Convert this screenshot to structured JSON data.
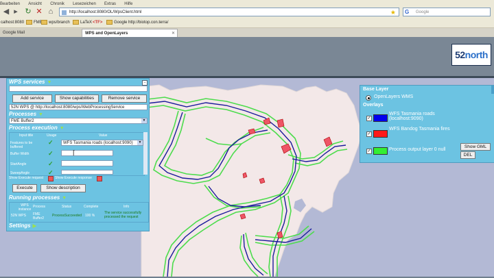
{
  "browser": {
    "menu": [
      "Bearbeiten",
      "Ansicht",
      "Chronik",
      "Lesezeichen",
      "Extras",
      "Hilfe"
    ],
    "url": "http://localhost:8080/OL/WpsClient.html",
    "search_placeholder": "Google",
    "bookmarks": [
      "calhost:8080",
      "FME",
      "wps/branch",
      "LaTeX",
      "<TF>",
      "Google",
      "http://biotop.con.terra/"
    ],
    "tabs": [
      "Google Mail",
      "WPS and OpenLayers"
    ]
  },
  "logo": {
    "prefix": "52",
    "suffix": "north"
  },
  "wps_panel": {
    "title": "WPS services",
    "buttons": {
      "add": "Add service",
      "capabilities": "Show capabilities",
      "remove": "Remove service"
    },
    "service_url": "52N WPS @ http://localhost:8080/wps/WebProcessingService",
    "processes_title": "Processes",
    "selected_process": "FME Buffer2",
    "execution_title": "Process execution",
    "exec_headers": [
      "Input title",
      "Usage",
      "Value"
    ],
    "exec_rows": [
      {
        "label": "Features to be buffered",
        "value": "WFS Tasmania roads (localhost:9090)"
      },
      {
        "label": "Buffer Width",
        "value": ""
      },
      {
        "label": "StartAngle",
        "value": ""
      },
      {
        "label": "SweepAngle",
        "value": ""
      }
    ],
    "request_links": [
      "Show Execute request",
      "Show Execute response"
    ],
    "execute_button": "Execute",
    "description_button": "Show description",
    "running_title": "Running processes",
    "running_headers": [
      "WPS instance",
      "Process",
      "Status",
      "Complete",
      "Info"
    ],
    "running_row": [
      "52N WPS",
      "FME Buffer2",
      "ProcessSucceeded",
      "100 %",
      "The service successfully processed the request"
    ],
    "settings_title": "Settings"
  },
  "layer_panel": {
    "base_title": "Base Layer",
    "base_layer": "OpenLayers WMS",
    "overlays_title": "Overlays",
    "overlays": [
      {
        "name": "WFS Tasmania roads (localhost:9090)",
        "color": "#0000ee"
      },
      {
        "name": "WFS Bandog Tasmania fires",
        "color": "#ff1a1a"
      },
      {
        "name": "Process output layer 0 null",
        "color": "#33ee33"
      }
    ],
    "show_gml": "Show GML",
    "del": "DEL"
  },
  "map_colors": {
    "water": "#b3b9d5",
    "land": "#f3e8e8",
    "buffer": "#4cdc4c",
    "roads": "#1a1a9a",
    "fires": "#ee5566"
  }
}
